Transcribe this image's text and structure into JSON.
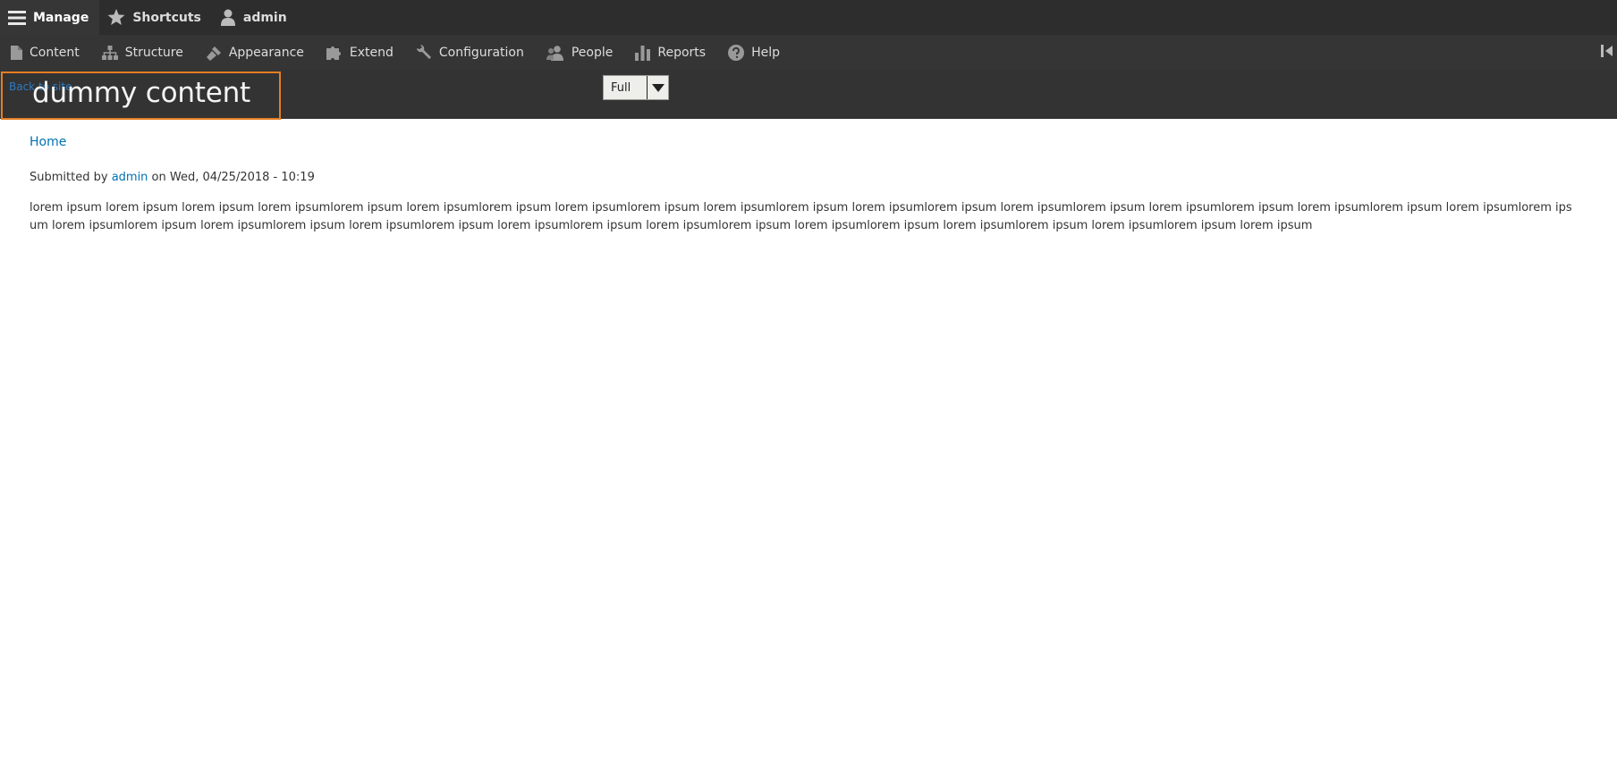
{
  "toolbar": {
    "manage_label": "Manage",
    "shortcuts_label": "Shortcuts",
    "user_label": "admin"
  },
  "tray": {
    "items": [
      {
        "label": "Content",
        "icon": "file-icon"
      },
      {
        "label": "Structure",
        "icon": "sitemap-icon"
      },
      {
        "label": "Appearance",
        "icon": "paintbrush-icon"
      },
      {
        "label": "Extend",
        "icon": "puzzle-icon"
      },
      {
        "label": "Configuration",
        "icon": "wrench-icon"
      },
      {
        "label": "People",
        "icon": "people-icon"
      },
      {
        "label": "Reports",
        "icon": "bar-chart-icon"
      },
      {
        "label": "Help",
        "icon": "help-icon"
      }
    ],
    "orientation_toggle_icon": "collapse-left-icon"
  },
  "display_header": {
    "back_link": "Back to site",
    "title": "dummy content",
    "view_mode_selected": "Full"
  },
  "main": {
    "breadcrumb": "Home",
    "submitted_prefix": "Submitted by ",
    "author": "admin",
    "submitted_suffix": " on Wed, 04/25/2018 - 10:19",
    "body": "lorem ipsum lorem ipsum lorem ipsum lorem ipsumlorem ipsum lorem ipsumlorem ipsum lorem ipsumlorem ipsum lorem ipsumlorem ipsum lorem ipsumlorem ipsum lorem ipsumlorem ipsum lorem ipsumlorem ipsum lorem ipsumlorem ipsum lorem ipsumlorem ipsum lorem ipsumlorem ipsum lorem ipsumlorem ipsum lorem ipsumlorem ipsum lorem ipsumlorem ipsum lorem ipsumlorem ipsum lorem ipsumlorem ipsum lorem ipsumlorem ipsum lorem ipsumlorem ipsum lorem ipsum"
  },
  "colors": {
    "toolbar_bg": "#2d2d2d",
    "tray_bg": "#353535",
    "header_bg": "#333333",
    "link": "#0071b3",
    "focus_outline": "#e67e22"
  }
}
